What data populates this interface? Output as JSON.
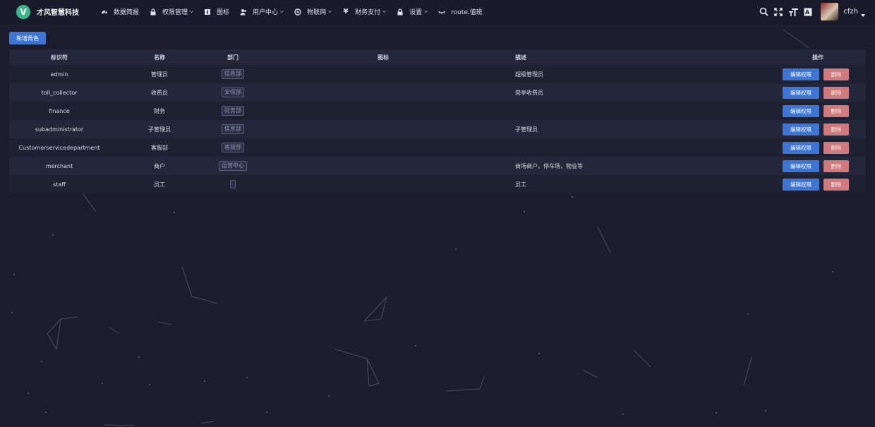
{
  "app": {
    "logo_letter": "V",
    "name": "才风智慧科技"
  },
  "nav": [
    {
      "label": "数据简报",
      "icon": "dashboard-icon",
      "has_dropdown": false
    },
    {
      "label": "权限管理",
      "icon": "lock-icon",
      "has_dropdown": true
    },
    {
      "label": "图标",
      "icon": "info-icon",
      "has_dropdown": false
    },
    {
      "label": "用户中心",
      "icon": "users-icon",
      "has_dropdown": true
    },
    {
      "label": "物联网",
      "icon": "globe-icon",
      "has_dropdown": true
    },
    {
      "label": "财务支付",
      "icon": "yen-icon",
      "has_dropdown": true
    },
    {
      "label": "设置",
      "icon": "lock-icon",
      "has_dropdown": true
    },
    {
      "label": "route.值班",
      "icon": "eye-closed-icon",
      "has_dropdown": false
    }
  ],
  "tools": [
    "search-icon",
    "fullscreen-icon",
    "font-size-icon",
    "translate-icon"
  ],
  "user": {
    "name": "cfzh"
  },
  "actions": {
    "add_role": "新增角色",
    "edit": "编辑权限",
    "delete": "删除"
  },
  "columns": {
    "id": "标识符",
    "name": "名称",
    "dept": "部门",
    "icon": "图标",
    "desc": "描述",
    "op": "操作"
  },
  "rows": [
    {
      "id": "admin",
      "name": "管理员",
      "dept": "信息部",
      "desc": "超级管理员"
    },
    {
      "id": "toll_collector",
      "name": "收费员",
      "dept": "安保部",
      "desc": "岗亭收费员"
    },
    {
      "id": "finance",
      "name": "财务",
      "dept": "财务部",
      "desc": ""
    },
    {
      "id": "subadministrator",
      "name": "子管理员",
      "dept": "信息部",
      "desc": "子管理员"
    },
    {
      "id": "Customerservicedepartment",
      "name": "客服部",
      "dept": "客服部",
      "desc": ""
    },
    {
      "id": "merchant",
      "name": "商户",
      "dept": "运营中心",
      "desc": "商场商户，停车场，物业等"
    },
    {
      "id": "staff",
      "name": "员工",
      "dept": "",
      "desc": "员工"
    }
  ]
}
